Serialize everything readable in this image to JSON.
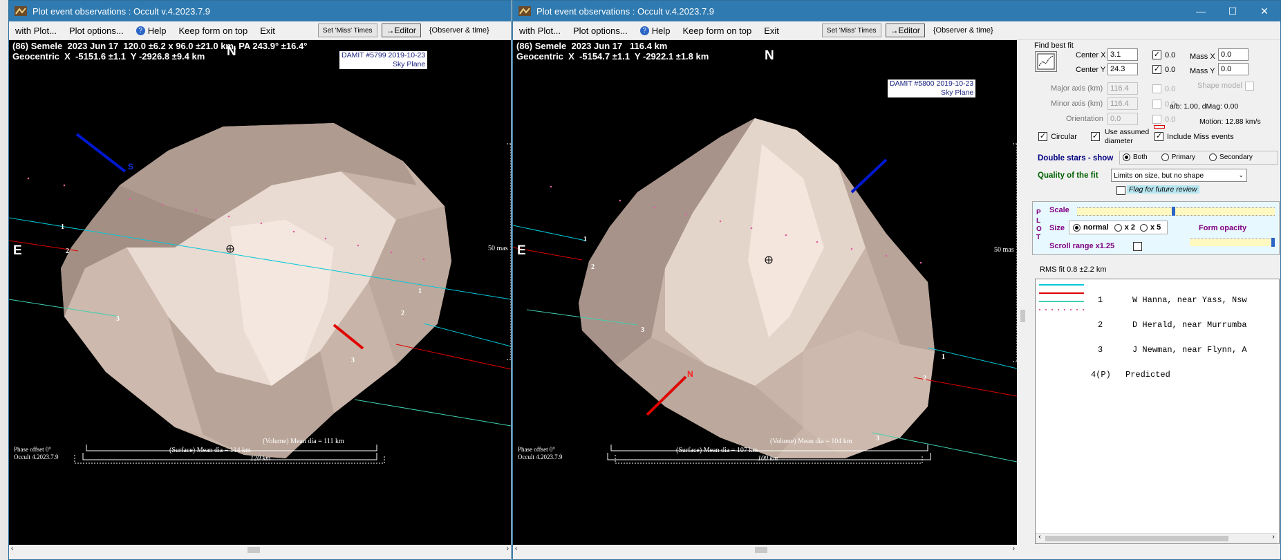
{
  "left_window": {
    "title": "Plot event observations : Occult v.4.2023.7.9",
    "menu": {
      "with_plot": "with Plot...",
      "plot_options": "Plot options...",
      "help": "Help",
      "keep_on_top": "Keep form on top",
      "exit": "Exit",
      "miss_times": "Set 'Miss' Times",
      "editor": "→Editor",
      "observer": "{Observer & time}"
    },
    "header_line1": "(86) Semele  2023 Jun 17  120.0 ±6.2 x 96.0 ±21.0 km, PA 243.9° ±16.4°",
    "header_line2": "Geocentric  X  -5151.6 ±1.1  Y -2926.8 ±9.4 km",
    "north": "N",
    "east": "E",
    "south_tag": "S",
    "damit_model": "DAMIT #5799 2019-10-23",
    "damit_plane": "Sky Plane",
    "scale_label": "50 mas",
    "chord_labels": [
      "1",
      "2",
      "3"
    ],
    "volume_dia": "(Volume) Mean dia = 111 km",
    "surface_dia": "(Surface) Mean dia = 114 km",
    "scale_km": "120 km",
    "phase_offset": "Phase offset 0°",
    "version": "Occult 4.2023.7.9"
  },
  "right_window": {
    "title": "Plot event observations : Occult v.4.2023.7.9",
    "menu": {
      "with_plot": "with Plot...",
      "plot_options": "Plot options...",
      "help": "Help",
      "keep_on_top": "Keep form on top",
      "exit": "Exit",
      "miss_times": "Set 'Miss' Times",
      "editor": "→Editor",
      "observer": "{Observer & time}"
    },
    "header_line1": "(86) Semele  2023 Jun 17   116.4 km",
    "header_line2": "Geocentric  X  -5154.7 ±1.1  Y -2922.1 ±1.8 km",
    "north": "N",
    "east": "E",
    "north_tag": "N",
    "damit_model": "DAMIT #5800 2019-10-23",
    "damit_plane": "Sky Plane",
    "scale_label": "50 mas",
    "chord_labels": [
      "1",
      "2",
      "3"
    ],
    "volume_dia": "(Volume) Mean dia = 104 km",
    "surface_dia": "(Surface) Mean dia = 107 km",
    "scale_km": "100 km",
    "phase_offset": "Phase offset 0°",
    "version": "Occult 4.2023.7.9",
    "window_controls": {
      "minimize": "—",
      "maximize": "☐",
      "close": "✕"
    }
  },
  "fit_panel": {
    "find_best_fit": "Find best fit",
    "center_x_label": "Center X",
    "center_x": "3.1",
    "center_x_delta": "0.0",
    "center_y_label": "Center Y",
    "center_y": "24.3",
    "center_y_delta": "0.0",
    "mass_x_label": "Mass X",
    "mass_x": "0.0",
    "mass_y_label": "Mass Y",
    "mass_y": "0.0",
    "major_label": "Major axis (km)",
    "major": "116.4",
    "major_delta": "0.0",
    "minor_label": "Minor axis (km)",
    "minor": "116.4",
    "minor_delta": "0.0",
    "orient_label": "Orientation",
    "orient": "0.0",
    "orient_delta": "0.0",
    "shape_model": "Shape model",
    "ab_ratio": "a/b: 1.00, dMag: 0.00",
    "motion": "Motion: 12.88 km/s",
    "circular": "Circular",
    "use_assumed": "Use assumed",
    "diameter": "diameter",
    "include_miss": "Include Miss events",
    "double_stars": "Double stars - show",
    "ds_both": "Both",
    "ds_primary": "Primary",
    "ds_secondary": "Secondary",
    "quality_label": "Quality of the fit",
    "quality_value": "Limits on size, but no shape",
    "flag_review": "Flag for future review",
    "plot_letters": [
      "P",
      "L",
      "O",
      "T"
    ],
    "scale": "Scale",
    "size": "Size",
    "size_normal": "normal",
    "size_x2": "x 2",
    "size_x5": "x 5",
    "form_opacity": "Form opacity",
    "scroll_range": "Scroll range x1.25",
    "rms_fit": "RMS fit 0.8 ±2.2 km",
    "legend": [
      {
        "num": "1",
        "text": "W Hanna, near Yass, Nsw",
        "color": "#00c8d8",
        "style": "solid"
      },
      {
        "num": "2",
        "text": "D Herald, near Murrumba",
        "color": "#e00000",
        "style": "solid"
      },
      {
        "num": "3",
        "text": "J Newman, near Flynn, A",
        "color": "#40d0b0",
        "style": "solid"
      },
      {
        "num": "4(P)",
        "text": "Predicted",
        "color": "#e060a0",
        "style": "dotted"
      }
    ]
  }
}
